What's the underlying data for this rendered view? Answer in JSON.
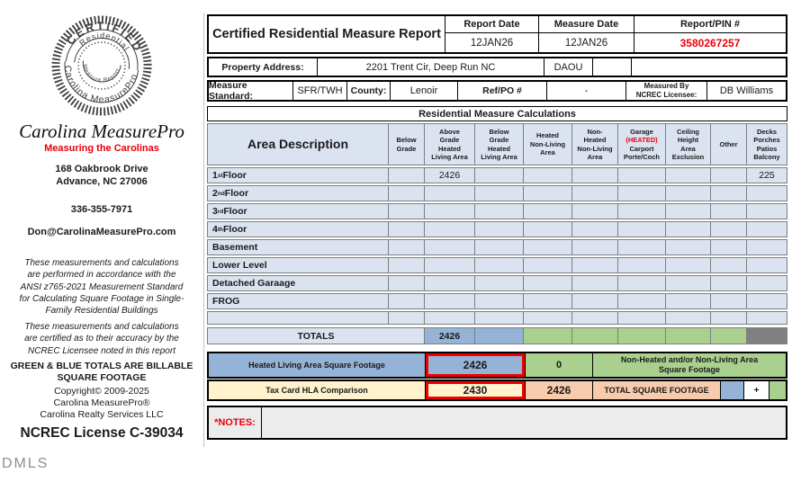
{
  "colors": {
    "row_light_blue": "#dbe2f0",
    "total_blue": "#95b3d7",
    "billable_green": "#a9d08e",
    "peach": "#f8cbad",
    "cream": "#fff2cc",
    "totals_gray": "#808080",
    "alert_red": "#e8000d",
    "notes_gray": "#ececec"
  },
  "sidebar": {
    "seal": {
      "arc_top": "CERTIFIED",
      "arc_mid": "Residential",
      "arc_center": "Measure Report",
      "arc_bottom": "Carolina MeasurePro"
    },
    "brand": "Carolina MeasurePro",
    "tagline": "Measuring the Carolinas",
    "address": "168 Oakbrook Drive\nAdvance, NC  27006",
    "phone": "336-355-7971",
    "email": "Don@CarolinaMeasurePro.com",
    "disclaimer1": "These measurements and calculations\nare performed in accordance with the\nANSI z765-2021 Measurement Standard\nfor Calculating Square Footage in Single-\nFamily Residential Buildings",
    "disclaimer2": "These measurements and calculations\nare certified as to their accuracy by the\nNCREC Licensee noted in this report",
    "billable_note": "GREEN & BLUE TOTALS ARE BILLABLE\nSQUARE FOOTAGE",
    "copyright": "Copyright© 2009-2025",
    "company1": "Carolina MeasurePro®",
    "company2": "Carolina Realty Services LLC",
    "license": "NCREC License C-39034",
    "watermark": "DMLS"
  },
  "header": {
    "title": "Certified Residential Measure Report",
    "report_date_label": "Report Date",
    "report_date": "12JAN26",
    "measure_date_label": "Measure Date",
    "measure_date": "12JAN26",
    "pin_label": "Report/PIN #",
    "pin": "3580267257"
  },
  "property": {
    "label": "Property Address:",
    "address": "2201 Trent Cir, Deep Run NC",
    "code": "DAOU"
  },
  "standard": {
    "label": "Measure Standard:",
    "value": "SFR/TWH",
    "county_label": "County:",
    "county": "Lenoir",
    "ref_label": "Ref/PO #",
    "ref": "-",
    "measured_by_label": "Measured By\nNCREC Licensee:",
    "measured_by": "DB Williams"
  },
  "table": {
    "section_title": "Residential Measure Calculations",
    "area_header": "Area Description",
    "columns": {
      "below_grade": "Below\nGrade",
      "above_heated": "Above\nGrade\nHeated\nLiving Area",
      "below_heated": "Below\nGrade\nHeated\nLiving Area",
      "heated_nonliving": "Heated\nNon-Living\nArea",
      "nonheated_nonliving": "Non-\nHeated\nNon-Living\nArea",
      "garage_line1": "Garage",
      "garage_heated": "(HEATED)",
      "garage_line2": "Carport",
      "garage_line3": "Porte/Coch",
      "ceiling": "Ceiling\nHeight\nArea\nExclusion",
      "other": "Other",
      "decks": "Decks\nPorches\nPatios\nBalcony"
    },
    "rows": [
      {
        "label": {
          "p": "1",
          "s": "st",
          "r": " Floor"
        },
        "values": {
          "above_heated": "2426",
          "decks": "225"
        }
      },
      {
        "label": {
          "p": "2",
          "s": "nd",
          "r": " Floor"
        },
        "values": {}
      },
      {
        "label": {
          "p": "3",
          "s": "rd",
          "r": " Floor"
        },
        "values": {}
      },
      {
        "label": {
          "p": "4",
          "s": "th",
          "r": " Floor"
        },
        "values": {}
      },
      {
        "label": {
          "p": "Basement",
          "s": "",
          "r": ""
        },
        "values": {}
      },
      {
        "label": {
          "p": "Lower Level",
          "s": "",
          "r": ""
        },
        "values": {}
      },
      {
        "label": {
          "p": "Detached Garaage",
          "s": "",
          "r": ""
        },
        "values": {}
      },
      {
        "label": {
          "p": "FROG",
          "s": "",
          "r": ""
        },
        "values": {}
      },
      {
        "label": {
          "p": "",
          "s": "",
          "r": ""
        },
        "values": {}
      }
    ],
    "totals": {
      "label": "TOTALS",
      "above_heated": "2426"
    }
  },
  "summary": {
    "heated_label": "Heated Living Area Square Footage",
    "heated_value": "2426",
    "nonheated_value": "0",
    "nonheated_label": "Non-Heated and/or Non-Living Area Square Footage",
    "taxcard_label": "Tax Card HLA Comparison",
    "taxcard_value": "2430",
    "total_value": "2426",
    "total_label": "TOTAL SQUARE FOOTAGE",
    "plus_sign": "+"
  },
  "notes": {
    "label": "*NOTES:"
  }
}
